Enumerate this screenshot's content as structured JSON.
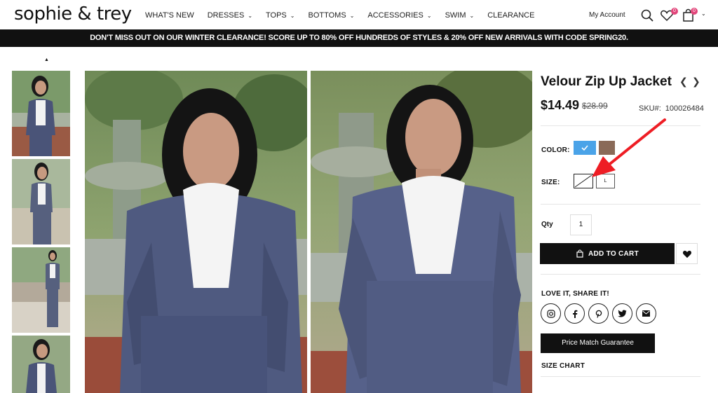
{
  "header": {
    "logo": "sophie & trey",
    "nav": [
      {
        "label": "WHAT'S NEW",
        "dropdown": false
      },
      {
        "label": "DRESSES",
        "dropdown": true
      },
      {
        "label": "TOPS",
        "dropdown": true
      },
      {
        "label": "BOTTOMS",
        "dropdown": true
      },
      {
        "label": "ACCESSORIES",
        "dropdown": true
      },
      {
        "label": "SWIM",
        "dropdown": true
      },
      {
        "label": "CLEARANCE",
        "dropdown": false
      }
    ],
    "account": "My Account",
    "wishlist_count": "0",
    "cart_count": "0"
  },
  "promo": "DON'T MISS OUT ON OUR WINTER CLEARANCE! SCORE UP TO 80% OFF HUNDREDS OF STYLES & 20% OFF NEW ARRIVALS WITH CODE SPRING20.",
  "product": {
    "title": "Velour Zip Up Jacket",
    "price": "$14.49",
    "old_price": "$28.99",
    "sku_label": "SKU#:",
    "sku": "100026484",
    "color_label": "COLOR:",
    "size_label": "SIZE:",
    "sizes": [
      "",
      "L"
    ],
    "qty_label": "Qty",
    "qty": "1",
    "add_to_cart": "ADD TO CART",
    "share_label": "LOVE IT, SHARE IT!",
    "price_match": "Price Match Guarantee",
    "size_chart": "SIZE CHART"
  },
  "colors": {
    "accent": "#e2457a",
    "swatch_blue": "#4aa3e8",
    "swatch_brown": "#8a6a58",
    "annotation": "#ee1d24"
  }
}
